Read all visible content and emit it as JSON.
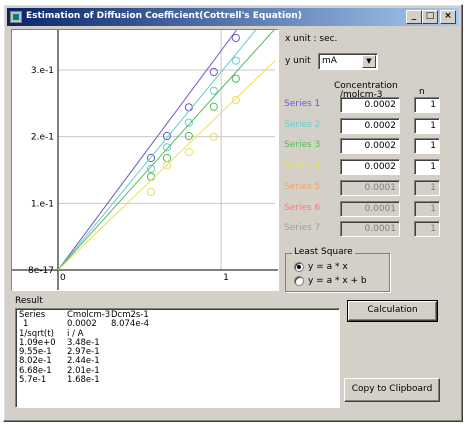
{
  "window": {
    "title": "Estimation of Diffusion Coefficient(Cottrell's Equation)",
    "minimize": "_",
    "maximize": "□",
    "close": "×"
  },
  "plot": {
    "y_ticks": [
      "8e-17",
      "1.e-1",
      "2.e-1",
      "3.e-1"
    ],
    "x_ticks": [
      "0",
      "1"
    ]
  },
  "controls": {
    "x_unit_label": "x unit : sec.",
    "y_unit_label": "y unit",
    "y_unit_value": "mA",
    "concentration_header": "Concentration",
    "concentration_unit": "/molcm-3",
    "n_header": "n"
  },
  "series": [
    {
      "name": "Series 1",
      "color": "#6a5acd",
      "concentration": "0.0002",
      "n": "1",
      "enabled": true
    },
    {
      "name": "Series 2",
      "color": "#66cdcc",
      "concentration": "0.0002",
      "n": "1",
      "enabled": true
    },
    {
      "name": "Series 3",
      "color": "#55bb55",
      "concentration": "0.0002",
      "n": "1",
      "enabled": true
    },
    {
      "name": "Series 4",
      "color": "#e8e060",
      "concentration": "0.0002",
      "n": "1",
      "enabled": true
    },
    {
      "name": "Series 5",
      "color": "#f0a070",
      "concentration": "0.0001",
      "n": "1",
      "enabled": false
    },
    {
      "name": "Series 6",
      "color": "#f08080",
      "concentration": "0.0001",
      "n": "1",
      "enabled": false
    },
    {
      "name": "Series 7",
      "color": "#a0a0a0",
      "concentration": "0.0001",
      "n": "1",
      "enabled": false
    }
  ],
  "least_square": {
    "label": "Least Square",
    "option1": "y = a * x",
    "option2": "y = a * x + b",
    "selected": "option1"
  },
  "buttons": {
    "calculation": "Calculation",
    "copy": "Copy to Clipboard"
  },
  "result": {
    "label": "Result",
    "header": [
      "Series",
      "Cmolcm-3",
      "Dcm2s-1"
    ],
    "summary": [
      "1",
      "0.0002",
      "8.074e-4"
    ],
    "table_header": [
      "1/sqrt(t)",
      "i / A"
    ],
    "rows": [
      [
        "1.09e+0",
        "3.48e-1"
      ],
      [
        "9.55e-1",
        "2.97e-1"
      ],
      [
        "8.02e-1",
        "2.44e-1"
      ],
      [
        "6.68e-1",
        "2.01e-1"
      ],
      [
        "5.7e-1",
        "1.68e-1"
      ]
    ]
  },
  "chart_data": {
    "type": "scatter",
    "xlabel": "",
    "ylabel": "",
    "xlim": [
      0,
      1.33
    ],
    "ylim": [
      0,
      0.36
    ],
    "x_ticks": [
      0,
      1
    ],
    "y_ticks": [
      0,
      0.1,
      0.2,
      0.3
    ],
    "series": [
      {
        "slope": 0.329,
        "color": "#6a5acd",
        "x": [
          0.57,
          0.668,
          0.802,
          0.955,
          1.09
        ],
        "y": [
          0.168,
          0.201,
          0.244,
          0.297,
          0.348
        ]
      },
      {
        "slope": 0.297,
        "color": "#66cdcc",
        "x": [
          0.57,
          0.668,
          0.802,
          0.955,
          1.09
        ],
        "y": [
          0.152,
          0.184,
          0.221,
          0.269,
          0.314
        ]
      },
      {
        "slope": 0.272,
        "color": "#55bb55",
        "x": [
          0.57,
          0.668,
          0.802,
          0.955,
          1.09
        ],
        "y": [
          0.14,
          0.168,
          0.201,
          0.245,
          0.287
        ]
      },
      {
        "slope": 0.236,
        "color": "#e8e060",
        "x": [
          0.57,
          0.668,
          0.802,
          0.955,
          1.09
        ],
        "y": [
          0.117,
          0.157,
          0.177,
          0.2,
          0.255
        ]
      }
    ]
  }
}
